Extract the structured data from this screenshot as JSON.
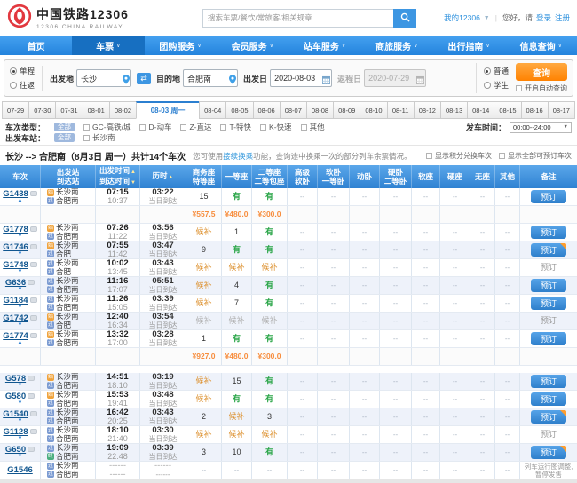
{
  "colors": {
    "nav_blue": "#2f82d2",
    "accent_orange": "#ff8201",
    "available_green": "#2aa548",
    "link_blue": "#2c90dd",
    "waitlist_orange": "#dd9231",
    "price_orange": "#f78d3d"
  },
  "header": {
    "logo_title": "中国铁路12306",
    "logo_subtitle": "12306 CHINA RAILWAY",
    "search_placeholder": "搜索车票/餐饮/常旅客/相关规章",
    "my12306": "我的12306",
    "greeting": "您好，请",
    "login": "登录",
    "register": "注册"
  },
  "nav": {
    "items": [
      {
        "label": "首页",
        "caret": false,
        "active": false
      },
      {
        "label": "车票",
        "caret": true,
        "active": true
      },
      {
        "label": "团购服务",
        "caret": true,
        "active": false
      },
      {
        "label": "会员服务",
        "caret": true,
        "active": false
      },
      {
        "label": "站车服务",
        "caret": true,
        "active": false
      },
      {
        "label": "商旅服务",
        "caret": true,
        "active": false
      },
      {
        "label": "出行指南",
        "caret": true,
        "active": false
      },
      {
        "label": "信息查询",
        "caret": true,
        "active": false
      }
    ]
  },
  "query_form": {
    "trip_type": [
      {
        "label": "单程",
        "checked": true
      },
      {
        "label": "往返",
        "checked": false
      }
    ],
    "from_label": "出发地",
    "from_value": "长沙",
    "to_label": "目的地",
    "to_value": "合肥南",
    "depart_label": "出发日",
    "depart_value": "2020-08-03",
    "return_label": "返程日",
    "return_value": "2020-07-29",
    "passenger_type": [
      {
        "label": "普通",
        "checked": true
      },
      {
        "label": "学生",
        "checked": false
      }
    ],
    "query_button": "查询",
    "auto_query_label": "开启自动查询"
  },
  "date_tabs": {
    "active_index": 5,
    "items": [
      "07-29",
      "07-30",
      "07-31",
      "08-01",
      "08-02",
      "08-03 周一",
      "08-04",
      "08-05",
      "08-06",
      "08-07",
      "08-08",
      "08-09",
      "08-10",
      "08-11",
      "08-12",
      "08-13",
      "08-14",
      "08-15",
      "08-16",
      "08-17"
    ]
  },
  "filters": {
    "type_label": "车次类型：",
    "all_badge": "全部",
    "type_options": [
      "GC-高铁/城",
      "D-动车",
      "Z-直达",
      "T-特快",
      "K-快速",
      "其他"
    ],
    "depart_time_label": "发车时间：",
    "depart_time_value": "00:00--24:00",
    "station_label": "出发车站：",
    "station_options": [
      "长沙南"
    ]
  },
  "result_bar": {
    "route": "长沙 --> 合肥南（8月3日 周一）",
    "count_text": "共计14个车次",
    "tip_pre": "您可使用",
    "tip_link": "接续换乘",
    "tip_post": "功能，查询途中换乘一次的部分列车余票情况。",
    "checkbox1": "显示积分兑换车次",
    "checkbox2": "显示全部可预订车次"
  },
  "table": {
    "book_label": "预订",
    "columns": [
      {
        "lines": [
          "车次"
        ]
      },
      {
        "lines": [
          "出发站",
          "到达站"
        ]
      },
      {
        "lines": [
          "出发时间",
          "到达时间"
        ],
        "sorts": [
          "asc",
          "desc"
        ]
      },
      {
        "lines": [
          "历时"
        ],
        "sorts": [
          "asc"
        ]
      },
      {
        "lines": [
          "商务座",
          "特等座"
        ]
      },
      {
        "lines": [
          "一等座"
        ]
      },
      {
        "lines": [
          "二等座",
          "二等包座"
        ]
      },
      {
        "lines": [
          "高级",
          "软卧"
        ]
      },
      {
        "lines": [
          "软卧",
          "一等卧"
        ]
      },
      {
        "lines": [
          "动卧"
        ]
      },
      {
        "lines": [
          "硬卧",
          "二等卧"
        ]
      },
      {
        "lines": [
          "软座"
        ]
      },
      {
        "lines": [
          "硬座"
        ]
      },
      {
        "lines": [
          "无座"
        ]
      },
      {
        "lines": [
          "其他"
        ]
      },
      {
        "lines": [
          "备注"
        ]
      }
    ],
    "rows": [
      {
        "type": "train",
        "code": "G1438",
        "fuxing": true,
        "arrow": "up",
        "from": [
          "始",
          "长沙南"
        ],
        "to": [
          "过",
          "合肥南"
        ],
        "dep": "07:15",
        "arr": "10:37",
        "dur": "03:22",
        "note": "当日到达",
        "seats": [
          [
            "15",
            "num"
          ],
          [
            "有",
            "have"
          ],
          [
            "有",
            "have"
          ],
          [
            "--",
            "none"
          ],
          [
            "--",
            "none"
          ],
          [
            "--",
            "none"
          ],
          [
            "--",
            "none"
          ],
          [
            "--",
            "none"
          ],
          [
            "--",
            "none"
          ],
          [
            "--",
            "none"
          ],
          [
            "--",
            "none"
          ]
        ],
        "book": "active"
      },
      {
        "type": "price",
        "prices": [
          "¥557.5",
          "¥480.0",
          "¥300.0"
        ]
      },
      {
        "type": "train",
        "code": "G1778",
        "fuxing": true,
        "arrow": "down",
        "from": [
          "始",
          "长沙南"
        ],
        "to": [
          "过",
          "合肥南"
        ],
        "dep": "07:26",
        "arr": "11:22",
        "dur": "03:56",
        "note": "当日到达",
        "seats": [
          [
            "候补",
            "wait"
          ],
          [
            "1",
            "num"
          ],
          [
            "有",
            "have"
          ],
          [
            "--",
            "none"
          ],
          [
            "--",
            "none"
          ],
          [
            "--",
            "none"
          ],
          [
            "--",
            "none"
          ],
          [
            "--",
            "none"
          ],
          [
            "--",
            "none"
          ],
          [
            "--",
            "none"
          ],
          [
            "--",
            "none"
          ]
        ],
        "book": "active"
      },
      {
        "type": "train",
        "code": "G1746",
        "fuxing": true,
        "arrow": "down",
        "from": [
          "始",
          "长沙南"
        ],
        "to": [
          "过",
          "合肥"
        ],
        "dep": "07:55",
        "arr": "11:42",
        "dur": "03:47",
        "note": "当日到达",
        "seats": [
          [
            "9",
            "num"
          ],
          [
            "有",
            "have"
          ],
          [
            "有",
            "have"
          ],
          [
            "--",
            "none"
          ],
          [
            "--",
            "none"
          ],
          [
            "--",
            "none"
          ],
          [
            "--",
            "none"
          ],
          [
            "--",
            "none"
          ],
          [
            "--",
            "none"
          ],
          [
            "--",
            "none"
          ],
          [
            "--",
            "none"
          ]
        ],
        "book": "active-corner"
      },
      {
        "type": "train",
        "code": "G1748",
        "fuxing": true,
        "arrow": "down",
        "from": [
          "过",
          "长沙南"
        ],
        "to": [
          "过",
          "合肥"
        ],
        "dep": "10:02",
        "arr": "13:45",
        "dur": "03:43",
        "note": "当日到达",
        "seats": [
          [
            "候补",
            "wait"
          ],
          [
            "候补",
            "wait"
          ],
          [
            "候补",
            "wait"
          ],
          [
            "--",
            "none"
          ],
          [
            "--",
            "none"
          ],
          [
            "--",
            "none"
          ],
          [
            "--",
            "none"
          ],
          [
            "--",
            "none"
          ],
          [
            "--",
            "none"
          ],
          [
            "--",
            "none"
          ],
          [
            "--",
            "none"
          ]
        ],
        "book": "disabled"
      },
      {
        "type": "train",
        "code": "G636",
        "fuxing": true,
        "arrow": "down",
        "from": [
          "过",
          "长沙南"
        ],
        "to": [
          "过",
          "合肥南"
        ],
        "dep": "11:16",
        "arr": "17:07",
        "dur": "05:51",
        "note": "当日到达",
        "seats": [
          [
            "候补",
            "wait"
          ],
          [
            "4",
            "num"
          ],
          [
            "有",
            "have"
          ],
          [
            "--",
            "none"
          ],
          [
            "--",
            "none"
          ],
          [
            "--",
            "none"
          ],
          [
            "--",
            "none"
          ],
          [
            "--",
            "none"
          ],
          [
            "--",
            "none"
          ],
          [
            "--",
            "none"
          ],
          [
            "--",
            "none"
          ]
        ],
        "book": "active"
      },
      {
        "type": "train",
        "code": "G1184",
        "fuxing": true,
        "arrow": "down",
        "from": [
          "过",
          "长沙南"
        ],
        "to": [
          "过",
          "合肥南"
        ],
        "dep": "11:26",
        "arr": "15:05",
        "dur": "03:39",
        "note": "当日到达",
        "seats": [
          [
            "候补",
            "wait"
          ],
          [
            "7",
            "num"
          ],
          [
            "有",
            "have"
          ],
          [
            "--",
            "none"
          ],
          [
            "--",
            "none"
          ],
          [
            "--",
            "none"
          ],
          [
            "--",
            "none"
          ],
          [
            "--",
            "none"
          ],
          [
            "--",
            "none"
          ],
          [
            "--",
            "none"
          ],
          [
            "--",
            "none"
          ]
        ],
        "book": "active"
      },
      {
        "type": "train",
        "code": "G1742",
        "fuxing": true,
        "arrow": "down",
        "from": [
          "始",
          "长沙南"
        ],
        "to": [
          "过",
          "合肥"
        ],
        "dep": "12:40",
        "arr": "16:34",
        "dur": "03:54",
        "note": "当日到达",
        "seats": [
          [
            "候补",
            "waitg"
          ],
          [
            "候补",
            "waitg"
          ],
          [
            "候补",
            "waitg"
          ],
          [
            "--",
            "none"
          ],
          [
            "--",
            "none"
          ],
          [
            "--",
            "none"
          ],
          [
            "--",
            "none"
          ],
          [
            "--",
            "none"
          ],
          [
            "--",
            "none"
          ],
          [
            "--",
            "none"
          ],
          [
            "--",
            "none"
          ]
        ],
        "book": "disabled"
      },
      {
        "type": "train",
        "code": "G1774",
        "fuxing": true,
        "arrow": "up",
        "from": [
          "始",
          "长沙南"
        ],
        "to": [
          "过",
          "合肥南"
        ],
        "dep": "13:32",
        "arr": "17:00",
        "dur": "03:28",
        "note": "当日到达",
        "seats": [
          [
            "1",
            "num"
          ],
          [
            "有",
            "have"
          ],
          [
            "有",
            "have"
          ],
          [
            "--",
            "none"
          ],
          [
            "--",
            "none"
          ],
          [
            "--",
            "none"
          ],
          [
            "--",
            "none"
          ],
          [
            "--",
            "none"
          ],
          [
            "--",
            "none"
          ],
          [
            "--",
            "none"
          ],
          [
            "--",
            "none"
          ]
        ],
        "book": "active"
      },
      {
        "type": "price",
        "prices": [
          "¥927.0",
          "¥480.0",
          "¥300.0"
        ]
      },
      {
        "type": "spacer"
      },
      {
        "type": "train",
        "code": "G578",
        "fuxing": true,
        "arrow": "down",
        "from": [
          "始",
          "长沙南"
        ],
        "to": [
          "过",
          "合肥南"
        ],
        "dep": "14:51",
        "arr": "18:10",
        "dur": "03:19",
        "note": "当日到达",
        "seats": [
          [
            "候补",
            "wait"
          ],
          [
            "15",
            "num"
          ],
          [
            "有",
            "have"
          ],
          [
            "--",
            "none"
          ],
          [
            "--",
            "none"
          ],
          [
            "--",
            "none"
          ],
          [
            "--",
            "none"
          ],
          [
            "--",
            "none"
          ],
          [
            "--",
            "none"
          ],
          [
            "--",
            "none"
          ],
          [
            "--",
            "none"
          ]
        ],
        "book": "active"
      },
      {
        "type": "train",
        "code": "G580",
        "fuxing": true,
        "arrow": "down",
        "from": [
          "始",
          "长沙南"
        ],
        "to": [
          "过",
          "合肥南"
        ],
        "dep": "15:53",
        "arr": "19:41",
        "dur": "03:48",
        "note": "当日到达",
        "seats": [
          [
            "候补",
            "wait"
          ],
          [
            "有",
            "have"
          ],
          [
            "有",
            "have"
          ],
          [
            "--",
            "none"
          ],
          [
            "--",
            "none"
          ],
          [
            "--",
            "none"
          ],
          [
            "--",
            "none"
          ],
          [
            "--",
            "none"
          ],
          [
            "--",
            "none"
          ],
          [
            "--",
            "none"
          ],
          [
            "--",
            "none"
          ]
        ],
        "book": "active"
      },
      {
        "type": "train",
        "code": "G1540",
        "fuxing": true,
        "arrow": "down",
        "from": [
          "过",
          "长沙南"
        ],
        "to": [
          "过",
          "合肥南"
        ],
        "dep": "16:42",
        "arr": "20:25",
        "dur": "03:43",
        "note": "当日到达",
        "seats": [
          [
            "2",
            "num"
          ],
          [
            "候补",
            "wait"
          ],
          [
            "3",
            "num"
          ],
          [
            "--",
            "none"
          ],
          [
            "--",
            "none"
          ],
          [
            "--",
            "none"
          ],
          [
            "--",
            "none"
          ],
          [
            "--",
            "none"
          ],
          [
            "--",
            "none"
          ],
          [
            "--",
            "none"
          ],
          [
            "--",
            "none"
          ]
        ],
        "book": "active-corner"
      },
      {
        "type": "train",
        "code": "G1128",
        "fuxing": true,
        "arrow": "down",
        "from": [
          "过",
          "长沙南"
        ],
        "to": [
          "过",
          "合肥南"
        ],
        "dep": "18:10",
        "arr": "21:40",
        "dur": "03:30",
        "note": "当日到达",
        "seats": [
          [
            "候补",
            "wait"
          ],
          [
            "候补",
            "wait"
          ],
          [
            "候补",
            "wait"
          ],
          [
            "--",
            "none"
          ],
          [
            "--",
            "none"
          ],
          [
            "--",
            "none"
          ],
          [
            "--",
            "none"
          ],
          [
            "--",
            "none"
          ],
          [
            "--",
            "none"
          ],
          [
            "--",
            "none"
          ],
          [
            "--",
            "none"
          ]
        ],
        "book": "disabled"
      },
      {
        "type": "train",
        "code": "G650",
        "fuxing": true,
        "arrow": "down",
        "from": [
          "过",
          "长沙南"
        ],
        "to": [
          "终",
          "合肥南"
        ],
        "dep": "19:09",
        "arr": "22:48",
        "dur": "03:39",
        "note": "当日到达",
        "seats": [
          [
            "3",
            "num"
          ],
          [
            "10",
            "num"
          ],
          [
            "有",
            "have"
          ],
          [
            "--",
            "none"
          ],
          [
            "--",
            "none"
          ],
          [
            "--",
            "none"
          ],
          [
            "--",
            "none"
          ],
          [
            "--",
            "none"
          ],
          [
            "--",
            "none"
          ],
          [
            "--",
            "none"
          ],
          [
            "--",
            "none"
          ]
        ],
        "book": "active-corner"
      },
      {
        "type": "train",
        "code": "G1546",
        "fuxing": false,
        "arrow": "none",
        "from": [
          "过",
          "长沙南"
        ],
        "to": [
          "过",
          "合肥南"
        ],
        "dep": "------",
        "arr": "------",
        "dur": "------",
        "note": "------",
        "seats": [
          [
            "--",
            "none"
          ],
          [
            "--",
            "none"
          ],
          [
            "--",
            "none"
          ],
          [
            "--",
            "none"
          ],
          [
            "--",
            "none"
          ],
          [
            "--",
            "none"
          ],
          [
            "--",
            "none"
          ],
          [
            "--",
            "none"
          ],
          [
            "--",
            "none"
          ],
          [
            "--",
            "none"
          ],
          [
            "--",
            "none"
          ]
        ],
        "book": "remark",
        "remark": "列车运行图调整,暂停发售"
      }
    ]
  }
}
